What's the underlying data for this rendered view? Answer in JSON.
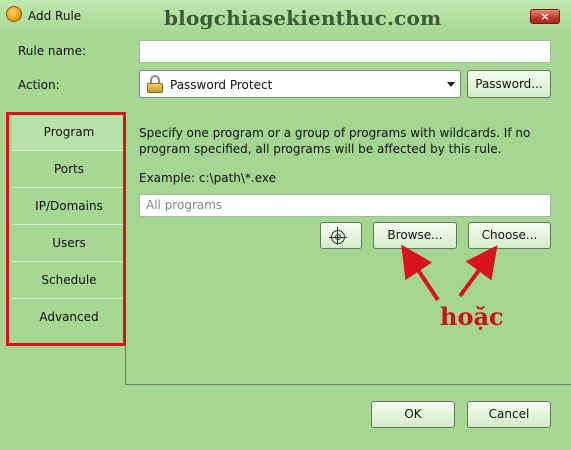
{
  "window": {
    "title": "Add Rule",
    "close_label": "×",
    "watermark": "blogchiasekienthuc.com"
  },
  "form": {
    "rule_name_label": "Rule name:",
    "rule_name_value": "",
    "action_label": "Action:",
    "action_value": "Password Protect",
    "password_button": "Password..."
  },
  "sidebar": {
    "items": [
      {
        "label": "Program",
        "active": true
      },
      {
        "label": "Ports",
        "active": false
      },
      {
        "label": "IP/Domains",
        "active": false
      },
      {
        "label": "Users",
        "active": false
      },
      {
        "label": "Schedule",
        "active": false
      },
      {
        "label": "Advanced",
        "active": false
      }
    ]
  },
  "program_panel": {
    "description": "Specify one program or a group of programs with wildcards. If no program specified, all programs will be affected by this rule.",
    "example": "Example: c:\\path\\*.exe",
    "program_placeholder": "All programs",
    "browse_button": "Browse...",
    "choose_button": "Choose..."
  },
  "annotation": {
    "text": "hoặc",
    "color": "#c8121e"
  },
  "footer": {
    "ok_button": "OK",
    "cancel_button": "Cancel"
  },
  "colors": {
    "background": "#a6d894",
    "highlight_box": "#d9121e"
  }
}
